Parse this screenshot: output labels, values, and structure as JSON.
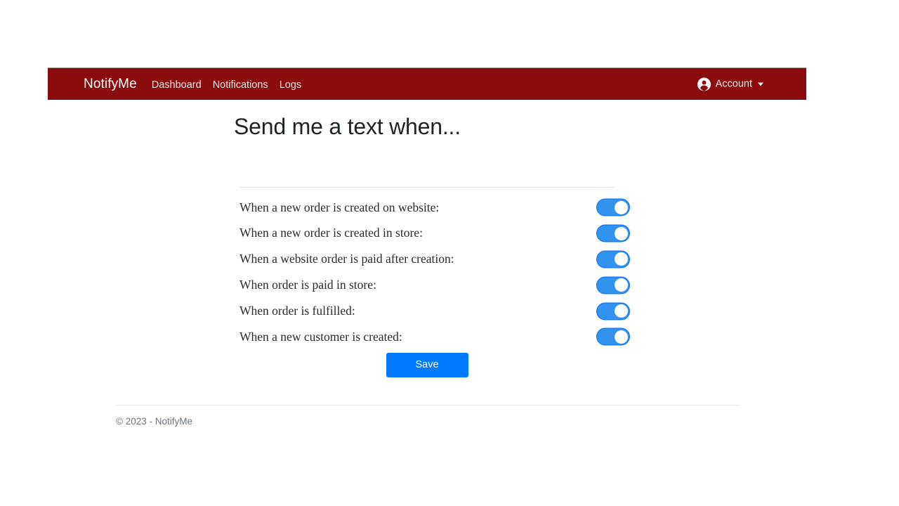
{
  "navbar": {
    "brand": "NotifyMe",
    "links": [
      {
        "label": "Dashboard"
      },
      {
        "label": "Notifications"
      },
      {
        "label": "Logs"
      }
    ],
    "account": {
      "label": "Account",
      "icon": "person-circle-icon",
      "caret": "chevron-down-icon"
    },
    "background_color": "#8a0c0c"
  },
  "main": {
    "title": "Send me a text when...",
    "settings": [
      {
        "label": "When a new order is created on website:",
        "enabled": true
      },
      {
        "label": "When a new order is created in store:",
        "enabled": true
      },
      {
        "label": "When a website order is paid after creation:",
        "enabled": true
      },
      {
        "label": "When order is paid in store:",
        "enabled": true
      },
      {
        "label": "When order is fulfilled:",
        "enabled": true
      },
      {
        "label": "When a new customer is created:",
        "enabled": true
      }
    ],
    "save_label": "Save",
    "accent_color": "#007bff",
    "toggle_on_color": "#3193ed"
  },
  "footer": {
    "text": "© 2023 - NotifyMe"
  }
}
